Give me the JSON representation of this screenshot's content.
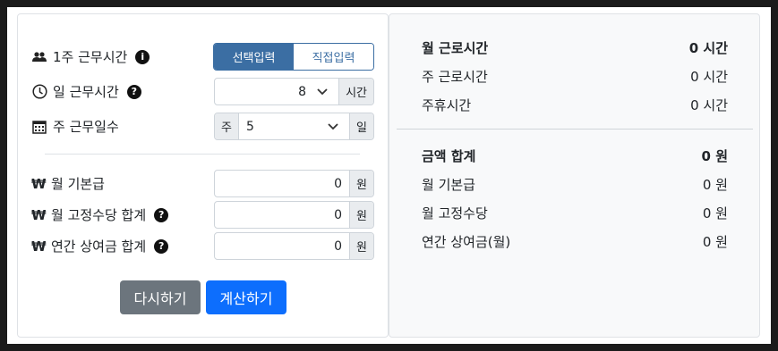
{
  "left": {
    "weekly_hours": {
      "label": "1주 근무시간",
      "toggle_selected": "선택입력",
      "toggle_other": "직접입력"
    },
    "daily_hours": {
      "label": "일 근무시간",
      "value": "8",
      "unit": "시간"
    },
    "work_days": {
      "label": "주 근무일수",
      "prefix": "주",
      "value": "5",
      "unit": "일"
    },
    "monthly_base": {
      "currency": "₩",
      "label": "월 기본급",
      "value": "0",
      "unit": "원"
    },
    "fixed_allowance": {
      "currency": "₩",
      "label": "월 고정수당 합계",
      "value": "0",
      "unit": "원"
    },
    "annual_bonus": {
      "currency": "₩",
      "label": "연간 상여금 합계",
      "value": "0",
      "unit": "원"
    },
    "buttons": {
      "reset": "다시하기",
      "calculate": "계산하기"
    }
  },
  "right": {
    "hours": [
      {
        "label": "월 근로시간",
        "value": "0 시간"
      },
      {
        "label": "주 근로시간",
        "value": "0 시간"
      },
      {
        "label": "주휴시간",
        "value": "0 시간"
      }
    ],
    "amounts": [
      {
        "label": "금액 합계",
        "value": "0 원"
      },
      {
        "label": "월 기본급",
        "value": "0 원"
      },
      {
        "label": "월 고정수당",
        "value": "0 원"
      },
      {
        "label": "연간 상여금(월)",
        "value": "0 원"
      }
    ]
  },
  "icons": [
    "people-icon",
    "info-icon",
    "clock-icon",
    "help-icon",
    "calendar-icon",
    "won-icon",
    "chevron-down-icon"
  ],
  "colors": {
    "primary": "#0d6efd",
    "secondary": "#6c757d",
    "toggle": "#3b6ea3",
    "panel": "#f8f9fa"
  }
}
